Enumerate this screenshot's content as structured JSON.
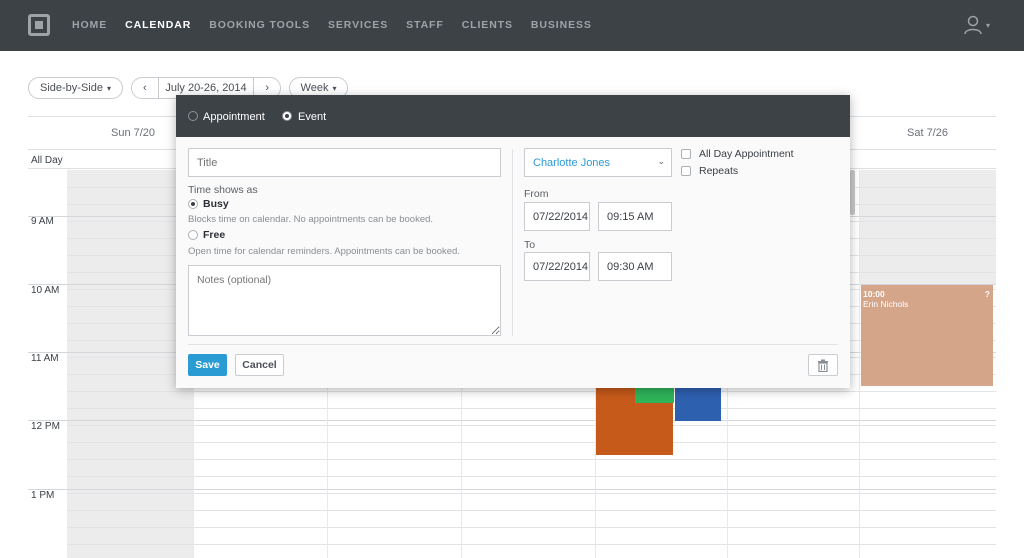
{
  "nav": {
    "items": [
      "HOME",
      "CALENDAR",
      "BOOKING TOOLS",
      "SERVICES",
      "STAFF",
      "CLIENTS",
      "BUSINESS"
    ],
    "active": "CALENDAR"
  },
  "toolbar": {
    "view_mode": "Side-by-Side",
    "date_range": "July 20-26, 2014",
    "prev": "‹",
    "next": "›",
    "period": "Week"
  },
  "calendar": {
    "day_headers": [
      "Sun 7/20",
      "Sat 7/26"
    ],
    "all_day_label": "All Day",
    "time_labels": [
      "9 AM",
      "10 AM",
      "11 AM",
      "12 PM",
      "1 PM"
    ],
    "appointment": {
      "time": "10:00",
      "name": "Erin Nichols",
      "badge": "?",
      "color": "#d4a589"
    },
    "event_colors": [
      "#c65a1a",
      "#2fb45a",
      "#2e60b0"
    ]
  },
  "modal": {
    "type_options": [
      "Appointment",
      "Event"
    ],
    "selected_type": "Event",
    "title_placeholder": "Title",
    "time_shows_as_label": "Time shows as",
    "busy_label": "Busy",
    "busy_hint": "Blocks time on calendar. No appointments can be booked.",
    "free_label": "Free",
    "free_hint": "Open time for calendar reminders. Appointments can be booked.",
    "notes_placeholder": "Notes (optional)",
    "staff_member": "Charlotte Jones",
    "from_label": "From",
    "from_date": "07/22/2014",
    "from_time": "09:15 AM",
    "to_label": "To",
    "to_date": "07/22/2014",
    "to_time": "09:30 AM",
    "all_day_label": "All Day Appointment",
    "repeats_label": "Repeats",
    "save_label": "Save",
    "cancel_label": "Cancel"
  },
  "colors": {
    "nav_bg": "#3d4247",
    "primary": "#2b9bd4"
  }
}
